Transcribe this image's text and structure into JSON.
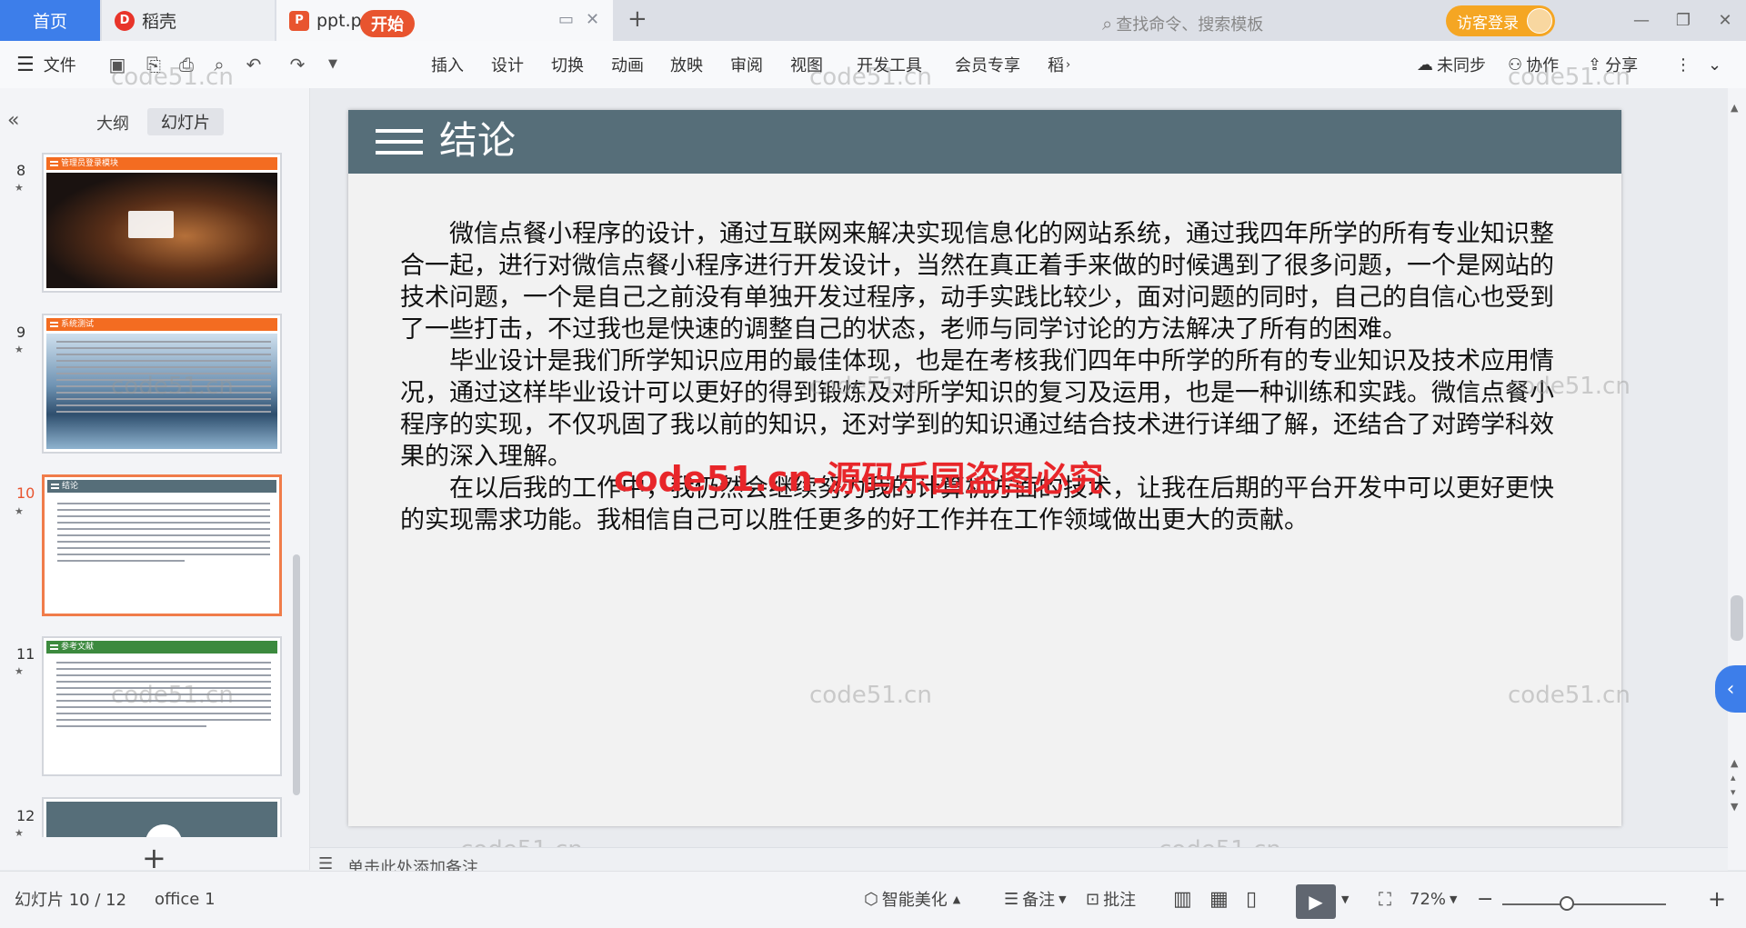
{
  "tabs": {
    "home": "首页",
    "daoke": "稻壳",
    "file": "ppt.pptx",
    "login": "访客登录"
  },
  "toolbar": {
    "file_menu": "文件",
    "tabs": [
      "开始",
      "插入",
      "设计",
      "切换",
      "动画",
      "放映",
      "审阅",
      "视图",
      "开发工具",
      "会员专享",
      "稻"
    ],
    "search_placeholder": "查找命令、搜索模板",
    "sync": "未同步",
    "collab": "协作",
    "share": "分享"
  },
  "left_panel": {
    "view_outline": "大纲",
    "view_slides": "幻灯片",
    "thumbnails": [
      {
        "num": "8",
        "title": "管理员登录模块",
        "color": "#f36c21"
      },
      {
        "num": "9",
        "title": "系统测试",
        "color": "#f36c21"
      },
      {
        "num": "10",
        "title": "结论",
        "color": "#566e79"
      },
      {
        "num": "11",
        "title": "参考文献",
        "color": "#3c8a3e"
      },
      {
        "num": "12",
        "title": "",
        "color": "#566e79"
      }
    ]
  },
  "slide": {
    "title": "结论",
    "paragraphs": [
      "微信点餐小程序的设计，通过互联网来解决实现信息化的网站系统，通过我四年所学的所有专业知识整合一起，进行对微信点餐小程序进行开发设计，当然在真正着手来做的时候遇到了很多问题，一个是网站的技术问题，一个是自己之前没有单独开发过程序，动手实践比较少，面对问题的同时，自己的自信心也受到了一些打击，不过我也是快速的调整自己的状态，老师与同学讨论的方法解决了所有的困难。",
      "毕业设计是我们所学知识应用的最佳体现，也是在考核我们四年中所学的所有的专业知识及技术应用情况，通过这样毕业设计可以更好的得到锻炼及对所学知识的复习及运用，也是一种训练和实践。微信点餐小程序的实现，不仅巩固了我以前的知识，还对学到的知识通过结合技术进行详细了解，还结合了对跨学科效果的深入理解。",
      "在以后我的工作中，我仍然会继续努力我的计算机方面的技术，让我在后期的平台开发中可以更好更快的实现需求功能。我相信自己可以胜任更多的好工作并在工作领域做出更大的贡献。"
    ]
  },
  "watermark": {
    "small": "code51.cn",
    "big": "code51.cn-源码乐园盗图必究"
  },
  "notes_placeholder": "单击此处添加备注",
  "status": {
    "slide_count": "幻灯片 10 / 12",
    "theme": "office 1",
    "beautify": "智能美化",
    "notes": "备注",
    "comment": "批注",
    "zoom": "72%"
  },
  "colors": {
    "accent": "#3d7eea",
    "start_tab": "#e8542f",
    "slide_header": "#566e79",
    "login": "#f5a623"
  }
}
